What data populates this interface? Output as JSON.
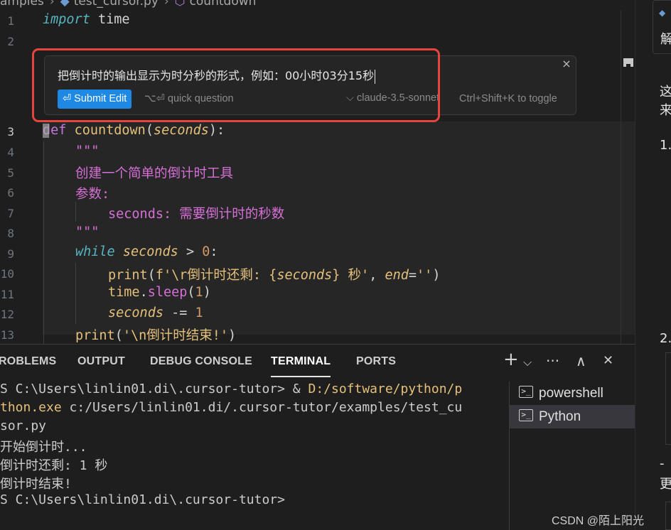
{
  "breadcrumb": {
    "folder": "amples",
    "file": "test_cursor.py",
    "symbol": "countdown"
  },
  "editor": {
    "line_numbers": [
      "1",
      "2",
      "3",
      "4",
      "5",
      "6",
      "7",
      "8",
      "9",
      "10",
      "11",
      "12",
      "13"
    ],
    "code": {
      "l1_kw": "import",
      "l1_rest": " time",
      "l3_kw": "def",
      "l3_fn": "countdown",
      "l3_param": "seconds",
      "l4": "\"\"\"",
      "l5": "创建一个简单的倒计时工具",
      "l6": "参数:",
      "l7": "seconds: 需要倒计时的秒数",
      "l8": "\"\"\"",
      "l9_kw": "while",
      "l9_var": "seconds",
      "l9_op": " > ",
      "l9_num": "0",
      "l10_fn": "print",
      "l10_str1": "f'\\r倒计时还剩: {",
      "l10_var": "seconds",
      "l10_str2": "} 秒'",
      "l10_kw": "end",
      "l10_str3": "''",
      "l11_mod": "time",
      "l11_fn": "sleep",
      "l11_num": "1",
      "l12_var": "seconds",
      "l12_op": " -= ",
      "l12_num": "1",
      "l13_fn": "print",
      "l13_str": "'\\n倒计时结束!'"
    }
  },
  "inline_edit": {
    "prompt": "把倒计时的输出显示为时分秒的形式，例如：00小时03分15秒",
    "submit_label": "⏎ Submit Edit",
    "quick_question": "⌥⏎ quick question",
    "model": "⌵ claude-3.5-sonnet",
    "toggle_hint": "Ctrl+Shift+K to toggle",
    "close_icon": "×"
  },
  "panel": {
    "tabs": [
      "ROBLEMS",
      "OUTPUT",
      "DEBUG CONSOLE",
      "TERMINAL",
      "PORTS"
    ],
    "active_tab": "TERMINAL",
    "icons": {
      "add": "+",
      "dropdown": "⌵",
      "more": "···",
      "maximize": "∧",
      "close": "✕"
    }
  },
  "terminal": {
    "lines": [
      {
        "a": "S C:\\Users\\linlin01.di\\.cursor-tutor> & ",
        "b": "D:/software/python/p"
      },
      {
        "a": "",
        "b": "thon.exe",
        "c": " c:/Users/linlin01.di/.cursor-tutor/examples/test_cu"
      },
      {
        "a": "sor.py"
      },
      {
        "a": "开始倒计时..."
      },
      {
        "a": "倒计时还剩: 1 秒"
      },
      {
        "a": "倒计时结束!"
      },
      {
        "a": "S C:\\Users\\linlin01.di\\.cursor-tutor>"
      }
    ]
  },
  "terminal_list": {
    "items": [
      "powershell",
      "Python"
    ],
    "selected": "Python"
  },
  "side_panel": {
    "tab_text": "解",
    "text1": "这",
    "text2": "来",
    "item1": "1.",
    "item2": "2.",
    "dash": "-",
    "text3": "更"
  },
  "watermark": "CSDN @陌上阳光"
}
